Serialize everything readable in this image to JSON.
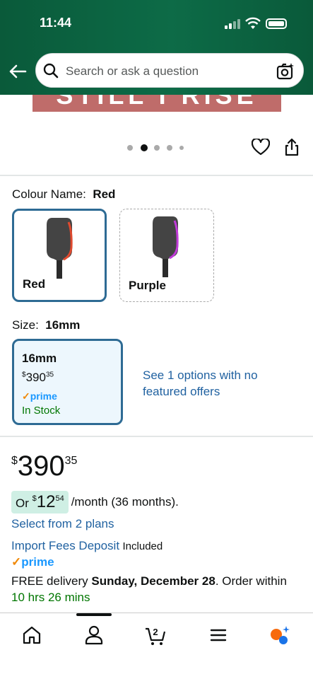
{
  "status_bar": {
    "time": "11:44"
  },
  "search": {
    "placeholder": "Search or ask a question"
  },
  "colour": {
    "label": "Colour Name:",
    "selected": "Red",
    "options": [
      {
        "name": "Red"
      },
      {
        "name": "Purple"
      }
    ]
  },
  "size": {
    "label": "Size:",
    "selected": "16mm",
    "card": {
      "name": "16mm",
      "currency": "$",
      "price_whole": "390",
      "price_frac": "35",
      "prime": "prime",
      "stock": "In Stock"
    },
    "see_options": "See 1 options with no featured offers"
  },
  "price": {
    "currency": "$",
    "whole": "390",
    "frac": "35"
  },
  "financing": {
    "prefix": "Or",
    "currency": "$",
    "whole": "12",
    "frac": "54",
    "suffix": "/month (36 months).",
    "plans_link": "Select from 2 plans"
  },
  "import_fees": {
    "link": "Import Fees Deposit",
    "status": "Included"
  },
  "prime_badge": "prime",
  "delivery": {
    "prefix": "FREE delivery",
    "date": "Sunday, December 28",
    "suffix": ". Order within",
    "countdown": "10 hrs 26 mins"
  },
  "banner_text": "STILL I RISE",
  "carousel": {
    "count": 5,
    "active": 1
  },
  "colors": {
    "accent": "#2e6b94",
    "link": "#2162a1",
    "green": "#007600",
    "header": "#0d6b47"
  }
}
